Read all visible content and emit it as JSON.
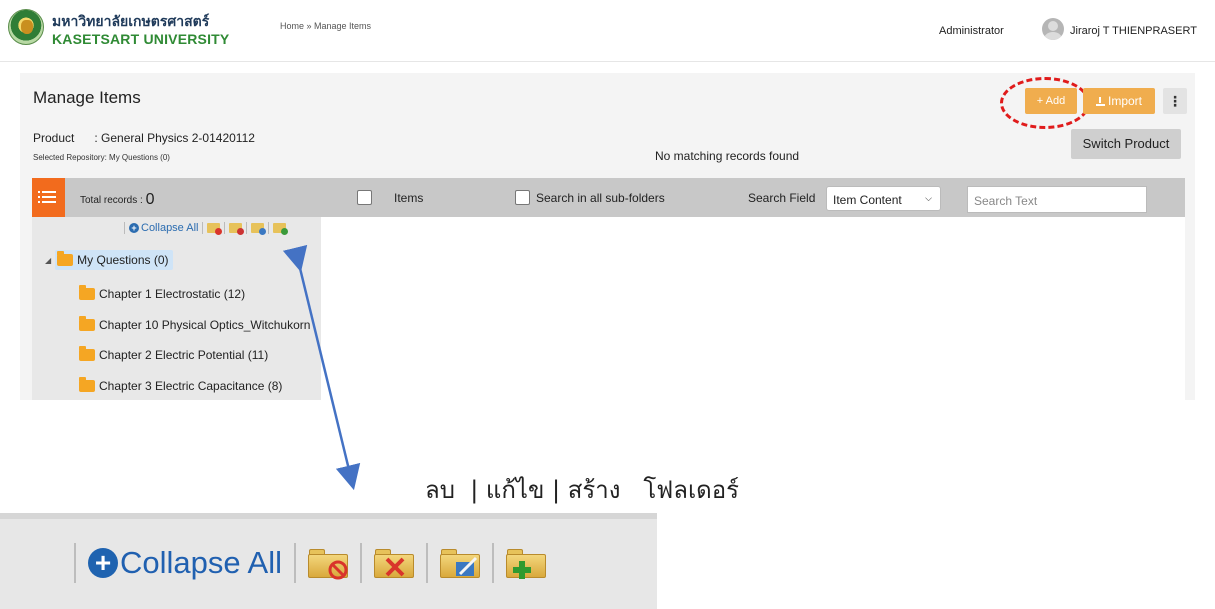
{
  "header": {
    "university_th": "มหาวิทยาลัยเกษตรศาสตร์",
    "university_en": "KASETSART UNIVERSITY",
    "breadcrumb": "Home » Manage Items",
    "role": "Administrator",
    "user_name": "Jiraroj  T THIENPRASERT"
  },
  "page": {
    "title": "Manage Items",
    "product_label": "Product",
    "product_value": ": General Physics 2-01420112",
    "repository": "Selected Repository: My Questions (0)"
  },
  "actions": {
    "add": "+ Add",
    "import": "Import",
    "more": "⋮",
    "switch_product": "Switch Product"
  },
  "toolbar": {
    "total_label": "Total records :",
    "total_value": "0",
    "items_label": "Items",
    "subfolders_label": "Search in all sub-folders",
    "search_field_label": "Search Field",
    "search_field_value": "Item Content",
    "search_placeholder": "Search Text"
  },
  "tree": {
    "collapse_all": "Collapse All",
    "root": "My Questions (0)",
    "children": [
      "Chapter 1 Electrostatic (12)",
      "Chapter 10 Physical Optics_Witchukorn",
      "Chapter 2 Electric Potential (11)",
      "Chapter 3 Electric Capacitance (8)"
    ]
  },
  "results": {
    "empty_message": "No matching records found"
  },
  "annotation": {
    "caption": "ลบ  | แก้ไข | สร้าง   โฟลเดอร์"
  },
  "zoom": {
    "collapse_all": "Collapse All"
  },
  "colors": {
    "accent_orange": "#f0ad4e",
    "toggle_orange": "#f26b1d",
    "highlight_red": "#e01b1b",
    "arrow_blue": "#4472c4",
    "link_blue": "#2b6cb0"
  }
}
